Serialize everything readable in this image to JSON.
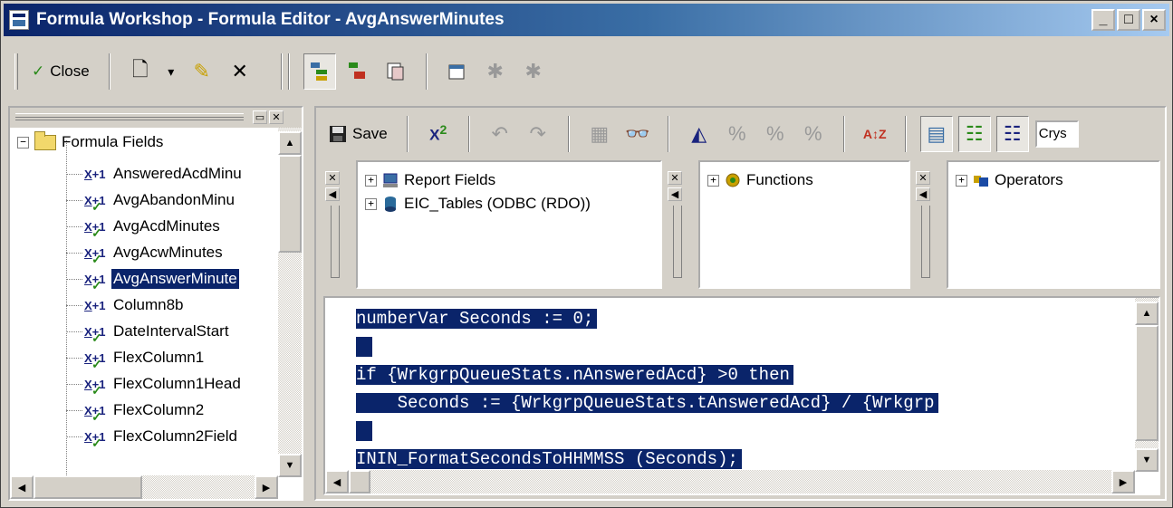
{
  "window": {
    "title": "Formula Workshop - Formula Editor - AvgAnswerMinutes",
    "minimize": "_",
    "maximize": "□",
    "close": "×"
  },
  "toolbar": {
    "close_label": "Close",
    "new_icon": "🗋",
    "dropdown_arrow": "▾",
    "wand_icon": "✎",
    "delete_icon": "✕",
    "close_icon": "✓"
  },
  "tree": {
    "root_label": "Formula Fields",
    "items": [
      {
        "label": "AnsweredAcdMinu",
        "checked": false
      },
      {
        "label": "AvgAbandonMinu",
        "checked": true
      },
      {
        "label": "AvgAcdMinutes",
        "checked": true
      },
      {
        "label": "AvgAcwMinutes",
        "checked": true
      },
      {
        "label": "AvgAnswerMinute",
        "checked": true,
        "selected": true
      },
      {
        "label": "Column8b",
        "checked": false
      },
      {
        "label": "DateIntervalStart",
        "checked": true
      },
      {
        "label": "FlexColumn1",
        "checked": true
      },
      {
        "label": "FlexColumn1Head",
        "checked": true
      },
      {
        "label": "FlexColumn2",
        "checked": true
      },
      {
        "label": "FlexColumn2Field",
        "checked": true
      }
    ]
  },
  "editor_toolbar": {
    "save_label": "Save",
    "crys_label": "Crys"
  },
  "browsers": {
    "fields": [
      "Report Fields",
      "EIC_Tables (ODBC (RDO))"
    ],
    "functions": "Functions",
    "operators": "Operators"
  },
  "code": [
    "numberVar Seconds := 0;",
    "",
    "if {WrkgrpQueueStats.nAnsweredAcd} >0 then",
    "    Seconds := {WrkgrpQueueStats.tAnsweredAcd} / {Wrkgrp",
    "",
    "ININ_FormatSecondsToHHMMSS (Seconds);"
  ],
  "colors": {
    "selection": "#0a246a",
    "title_start": "#0a246a",
    "face": "#d4d0c8"
  }
}
